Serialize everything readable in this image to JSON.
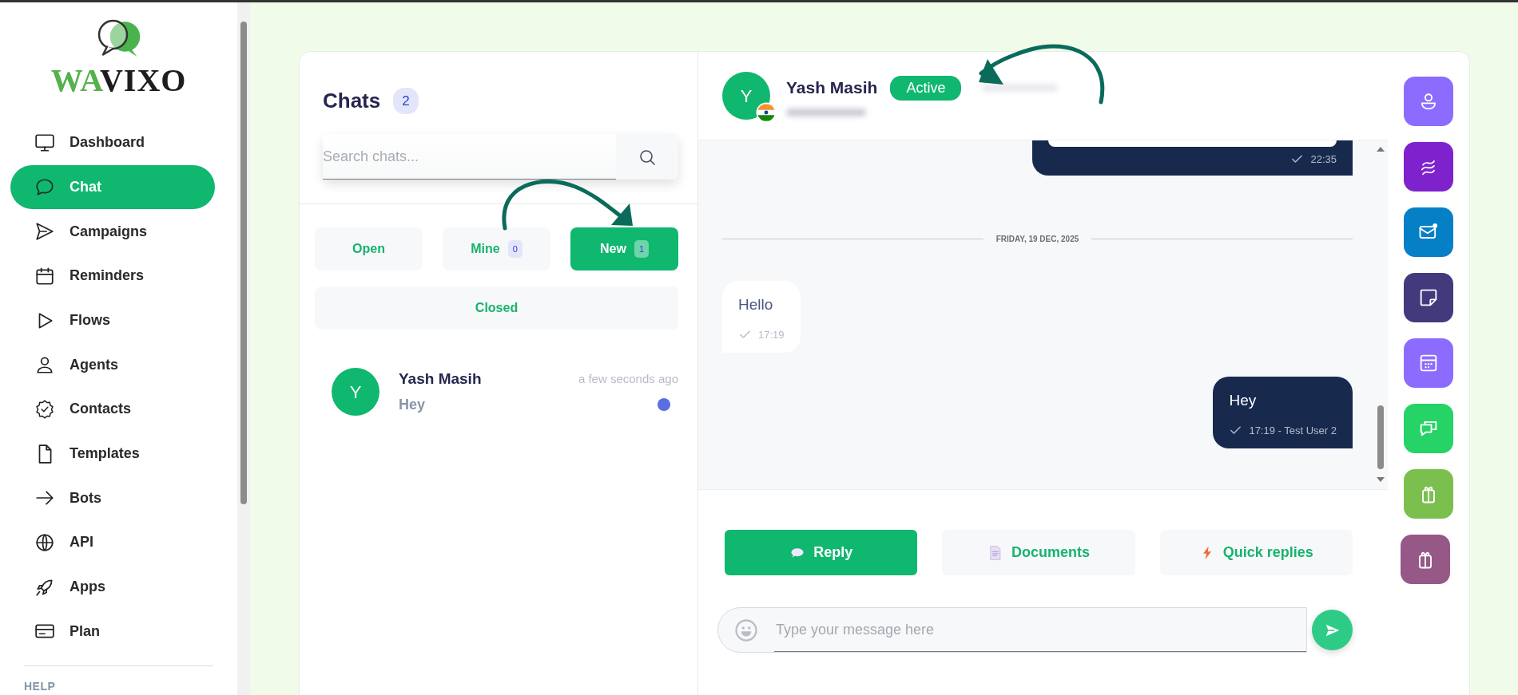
{
  "sidebar": {
    "logo": {
      "part_1": "WA",
      "part_2": "VIXO"
    },
    "items": [
      {
        "label": "Dashboard",
        "selected": false
      },
      {
        "label": "Chat",
        "selected": true
      },
      {
        "label": "Campaigns",
        "selected": false
      },
      {
        "label": "Reminders",
        "selected": false
      },
      {
        "label": "Flows",
        "selected": false
      },
      {
        "label": "Agents",
        "selected": false
      },
      {
        "label": "Contacts",
        "selected": false
      },
      {
        "label": "Templates",
        "selected": false
      },
      {
        "label": "Bots",
        "selected": false
      },
      {
        "label": "API",
        "selected": false
      },
      {
        "label": "Apps",
        "selected": false
      },
      {
        "label": "Plan",
        "selected": false
      }
    ],
    "section_heading": "HELP"
  },
  "chat_list": {
    "title": "Chats",
    "count": "2",
    "search": {
      "placeholder": "Search chats..."
    },
    "filters": [
      {
        "label": "Open",
        "selected": false
      },
      {
        "label": "Mine",
        "count": "0",
        "selected": false
      },
      {
        "label": "New",
        "count": "1",
        "selected": true
      },
      {
        "label": "Closed",
        "selected": false
      }
    ],
    "conversations": [
      {
        "avatar": "Y",
        "name": "Yash Masih",
        "preview": "Hey",
        "time": "a few seconds ago",
        "unread": true
      }
    ]
  },
  "chat": {
    "contact": {
      "avatar": "Y",
      "name": "Yash Masih",
      "status": "Active"
    },
    "messages": [
      {
        "kind": "outgoing",
        "time": "22:35",
        "partial": true
      },
      {
        "kind": "date",
        "text": "FRIDAY, 19 DEC, 2025"
      },
      {
        "kind": "incoming",
        "text": "Hello",
        "time": "17:19"
      },
      {
        "kind": "outgoing",
        "text": "Hey",
        "time": "17:19 - Test User 2"
      }
    ],
    "compose_tabs": [
      {
        "label": "Reply",
        "selected": true
      },
      {
        "label": "Documents",
        "selected": false
      },
      {
        "label": "Quick replies",
        "selected": false
      }
    ],
    "message_input": {
      "placeholder": "Type your message here"
    }
  },
  "tool_rail": [
    {
      "color": "#8b6cff"
    },
    {
      "color": "#7e22ce"
    },
    {
      "color": "#0580c7"
    },
    {
      "color": "#433a7d"
    },
    {
      "color": "#8b6cff"
    },
    {
      "color": "#25d366"
    },
    {
      "color": "#7bbf4f"
    },
    {
      "color": "#955887"
    }
  ]
}
